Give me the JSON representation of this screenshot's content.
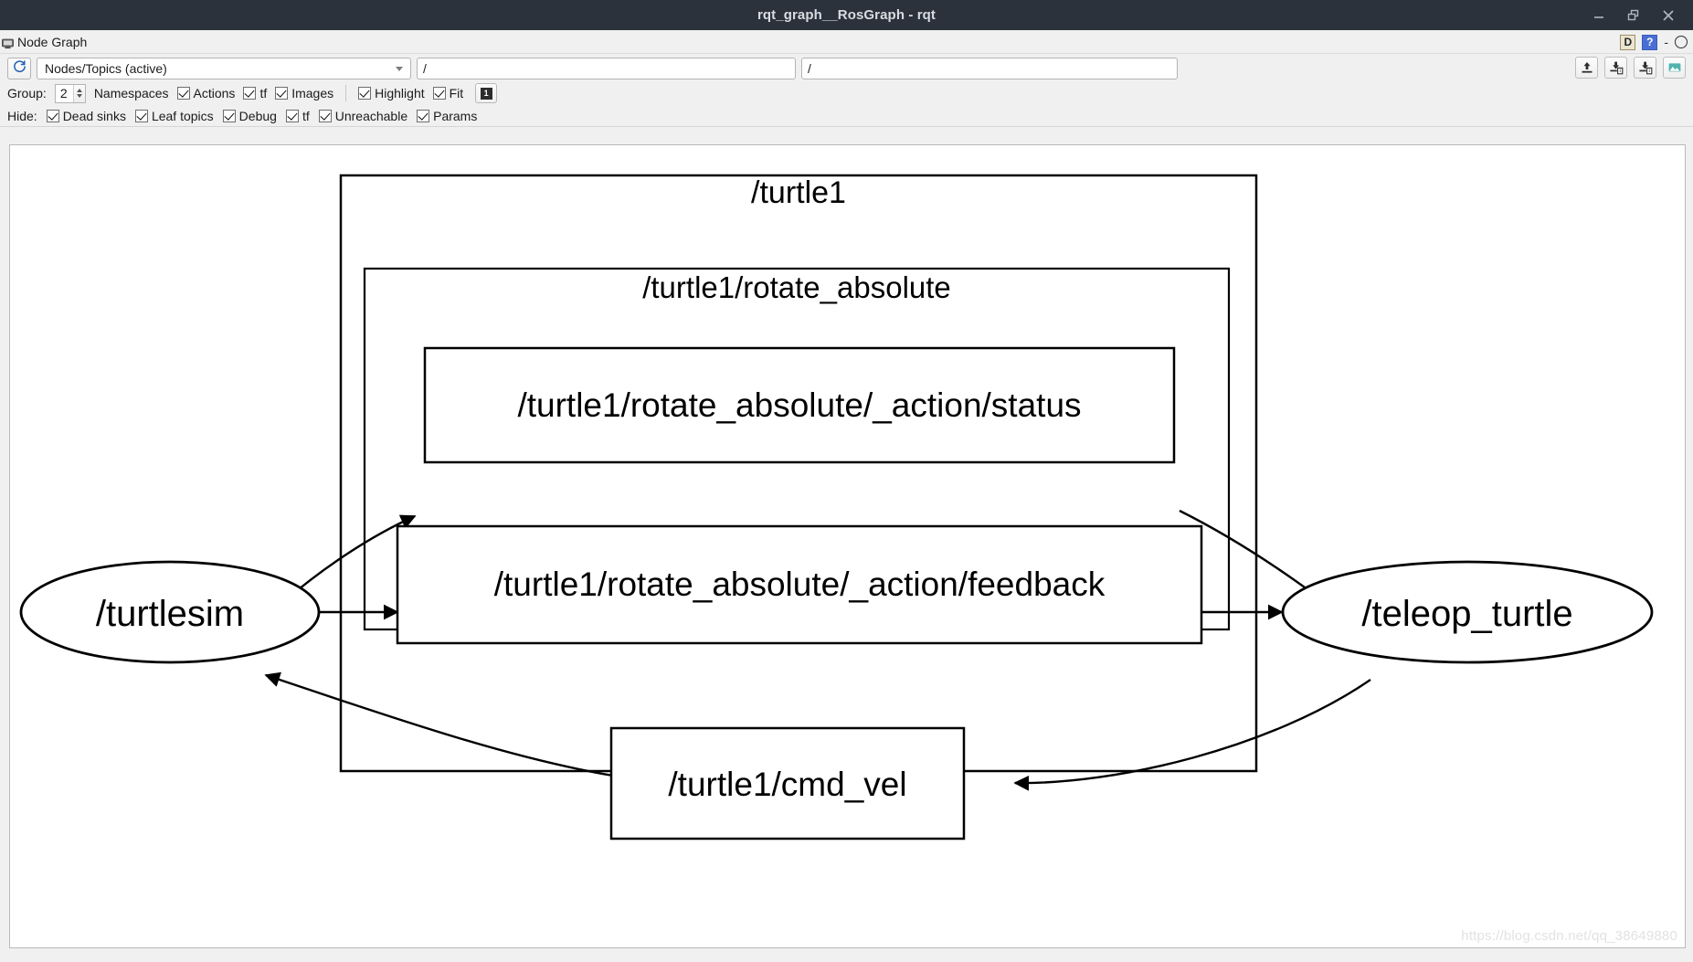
{
  "window": {
    "title": "rqt_graph__RosGraph - rqt",
    "minimize_label": "minimize-window",
    "restore_label": "restore-window",
    "close_label": "close-window"
  },
  "dock": {
    "title": "Node Graph",
    "float_label": "D",
    "help_label": "?",
    "minimize_label": "-",
    "close_label": "O"
  },
  "toolbar": {
    "refresh_tooltip": "Refresh",
    "graph_type": "Nodes/Topics (active)",
    "filter_value": "/",
    "topic_value": "/",
    "group_label": "Group:",
    "group_value": "2",
    "namespaces_label": "Namespaces",
    "actions_label": "Actions",
    "tf_label": "tf",
    "images_label": "Images",
    "highlight_label": "Highlight",
    "fit_label": "Fit",
    "zoom_button_label": "1",
    "hide_label": "Hide:",
    "hide_items": [
      {
        "label": "Dead sinks",
        "checked": true
      },
      {
        "label": "Leaf topics",
        "checked": true
      },
      {
        "label": "Debug",
        "checked": true
      },
      {
        "label": "tf",
        "checked": true
      },
      {
        "label": "Unreachable",
        "checked": true
      },
      {
        "label": "Params",
        "checked": true
      }
    ],
    "checks": [
      {
        "label": "Actions",
        "checked": true
      },
      {
        "label": "tf",
        "checked": true
      },
      {
        "label": "Images",
        "checked": true
      },
      {
        "label": "Highlight",
        "checked": true
      },
      {
        "label": "Fit",
        "checked": true
      }
    ],
    "icons": [
      {
        "name": "load-dot-graph-icon"
      },
      {
        "name": "save-dot-graph-icon"
      },
      {
        "name": "save-as-dot-icon"
      },
      {
        "name": "save-as-image-icon"
      }
    ]
  },
  "graph": {
    "clusters": [
      {
        "id": "turtle1",
        "label": "/turtle1"
      },
      {
        "id": "rotate_absolute",
        "label": "/turtle1/rotate_absolute"
      }
    ],
    "topics": [
      {
        "id": "status",
        "label": "/turtle1/rotate_absolute/_action/status"
      },
      {
        "id": "feedback",
        "label": "/turtle1/rotate_absolute/_action/feedback"
      },
      {
        "id": "cmd_vel",
        "label": "/turtle1/cmd_vel"
      }
    ],
    "nodes": [
      {
        "id": "turtlesim",
        "label": "/turtlesim"
      },
      {
        "id": "teleop_turtle",
        "label": "/teleop_turtle"
      }
    ],
    "edges": [
      {
        "from": "turtlesim",
        "to": "status"
      },
      {
        "from": "status",
        "to": "teleop_turtle"
      },
      {
        "from": "turtlesim",
        "to": "feedback"
      },
      {
        "from": "feedback",
        "to": "teleop_turtle"
      },
      {
        "from": "teleop_turtle",
        "to": "cmd_vel"
      },
      {
        "from": "cmd_vel",
        "to": "turtlesim"
      }
    ]
  },
  "watermark": "https://blog.csdn.net/qq_38649880"
}
